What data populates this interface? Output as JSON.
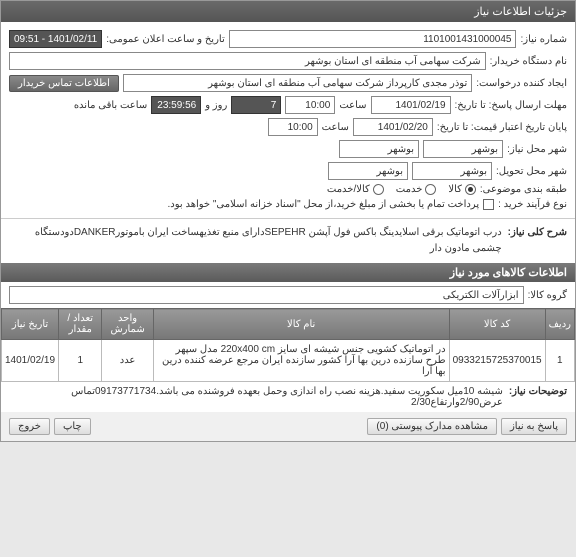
{
  "window": {
    "title": "جزئیات اطلاعات نیاز"
  },
  "fields": {
    "need_no_label": "شماره نیاز:",
    "need_no": "1101001431000045",
    "announce_label": "تاریخ و ساعت اعلان عمومی:",
    "announce": "1401/02/11 - 09:51",
    "buyer_label": "نام دستگاه خریدار:",
    "buyer": "شرکت سهامی آب منطقه ای استان بوشهر",
    "requester_label": "ایجاد کننده درخواست:",
    "requester": "توذر مجدی کارپرداز شرکت سهامی آب منطقه ای استان بوشهر",
    "contact_btn": "اطلاعات تماس خریدار",
    "deadline_label": "مهلت ارسال پاسخ: تا تاریخ:",
    "deadline_date": "1401/02/19",
    "time_label": "ساعت",
    "deadline_time": "10:00",
    "remain1": "7",
    "remain1_suffix": "روز و",
    "remain2": "23:59:56",
    "remain2_suffix": "ساعت باقی مانده",
    "valid_label": "پایان تاریخ اعتبار قیمت: تا تاریخ:",
    "valid_date": "1401/02/20",
    "valid_time": "10:00",
    "need_city_label": "شهر محل نیاز:",
    "delivery_city_label": "شهر محل تحویل:",
    "province": "بوشهر",
    "city": "بوشهر",
    "category_label": "طبقه بندی موضوعی:",
    "cat_goods": "کالا",
    "cat_service": "خدمت",
    "cat_goods_service": "کالا/خدمت",
    "buy_type_label": "نوع فرآیند خرید :",
    "buy_type_note": "پرداخت تمام یا بخشی از مبلغ خرید،از محل \"اسناد خزانه اسلامی\" خواهد بود."
  },
  "summary": {
    "label": "شرح کلی نیاز:",
    "text": "درب اتوماتیک برقی اسلایدینگ باکس فول آپشن SEPEHRدارای منبع تغذیهساخت ایران باموتورDANKERدودستگاه چشمی  مادون دار"
  },
  "goods_header": "اطلاعات کالاهای مورد نیاز",
  "group": {
    "label": "گروه کالا:",
    "value": "ابزارآلات الکتریکی"
  },
  "table": {
    "headers": {
      "row": "ردیف",
      "code": "کد کالا",
      "name": "نام کالا",
      "unit": "واحد شمارش",
      "qty": "تعداد / مقدار",
      "date": "تاریخ نیاز"
    },
    "rows": [
      {
        "row": "1",
        "code": "0933215725370015",
        "name": "در اتوماتیک کشویی جنس شیشه ای سایز 220x400 cm مدل سپهر طرح سازنده درین بها آرا کشور سازنده ایران مرجع عرضه کننده درین بها آرا",
        "unit": "عدد",
        "qty": "1",
        "date": "1401/02/19"
      }
    ]
  },
  "notes": {
    "label": "توضیحات نیاز:",
    "text": "شیشه 10میل سکوریت سفید.هزینه نصب راه اندازی وحمل بعهده فروشنده می باشد.09173771734تماس عرض2/90وارتفاع2/30"
  },
  "footer": {
    "reply": "پاسخ به نیاز",
    "attachments": "مشاهده مدارک پیوستی (0)",
    "print": "چاپ",
    "exit": "خروج"
  }
}
